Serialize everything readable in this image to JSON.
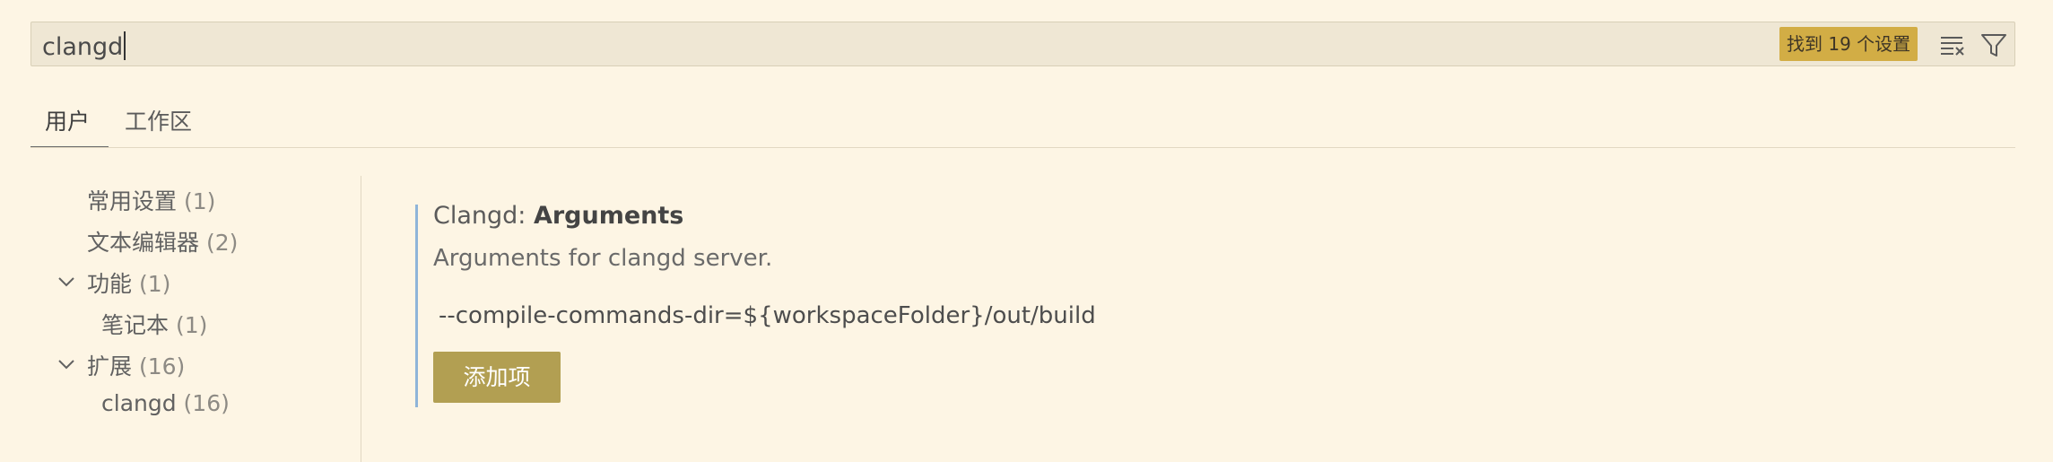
{
  "search": {
    "value": "clangd",
    "results_badge": "找到 19 个设置",
    "clear_icon": "clear-filter-icon",
    "filter_icon": "funnel-icon"
  },
  "tabs": [
    {
      "label": "用户",
      "active": true
    },
    {
      "label": "工作区",
      "active": false
    }
  ],
  "toc": [
    {
      "label": "常用设置",
      "count": "(1)",
      "expanded": null
    },
    {
      "label": "文本编辑器",
      "count": "(2)",
      "expanded": null
    },
    {
      "label": "功能",
      "count": "(1)",
      "expanded": true
    },
    {
      "label": "笔记本",
      "count": "(1)",
      "expanded": null
    },
    {
      "label": "扩展",
      "count": "(16)",
      "expanded": true
    },
    {
      "label": "clangd",
      "count": "(16)",
      "expanded": null
    }
  ],
  "setting": {
    "category": "Clangd: ",
    "name": "Arguments",
    "description": "Arguments for clangd server.",
    "value": "--compile-commands-dir=${workspaceFolder}/out/build",
    "add_button": "添加项"
  },
  "colors": {
    "background": "#fdf5e4",
    "badge": "#d2ad45",
    "button": "#b29f52",
    "accent_bar": "#8fb4d8"
  }
}
